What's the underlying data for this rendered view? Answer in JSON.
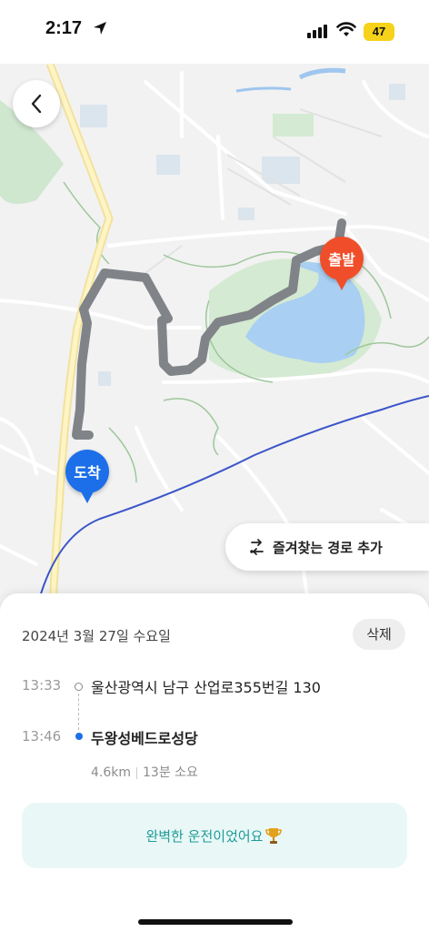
{
  "status": {
    "time": "2:17",
    "battery": "47"
  },
  "map": {
    "start_label": "출발",
    "end_label": "도착",
    "favorite_route_label": "즐겨찾는 경로 추가"
  },
  "trip": {
    "date": "2024년 3월 27일 수요일",
    "delete_label": "삭제",
    "origin_time": "13:33",
    "origin_address": "울산광역시 남구 산업로355번길 130",
    "dest_time": "13:46",
    "dest_name": "두왕성베드로성당",
    "distance": "4.6km",
    "duration": "13분 소요",
    "message": "완벽한 운전이었어요",
    "message_icon": "trophy-icon"
  },
  "colors": {
    "start_pin": "#f04e2a",
    "end_pin": "#1c6fe8",
    "route": "#808488",
    "message_text": "#1e9c96"
  }
}
